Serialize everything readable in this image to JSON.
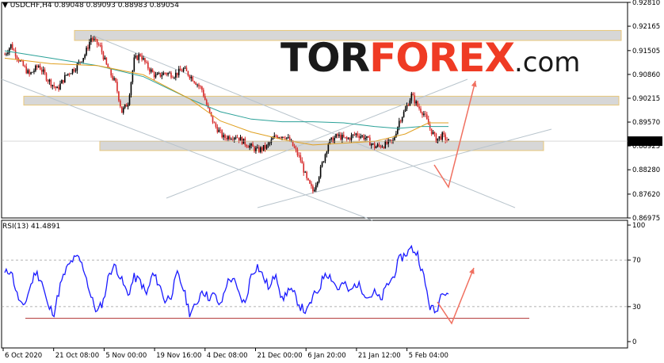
{
  "symbol": {
    "pair": "USDCHF",
    "timeframe": "H4",
    "open": "0.89048",
    "high": "0.89093",
    "low": "0.88983",
    "close": "0.89054"
  },
  "logo": {
    "part1": "TOR",
    "part2": "FOREX",
    "part3": ".com"
  },
  "rsi": {
    "label": "RSI(13) 41.4891"
  },
  "current_price": "0.89054",
  "colors": {
    "bull": "#000000",
    "bear": "#d62b2b",
    "ma_fast": "#e0a020",
    "ma_slow": "#2aa198",
    "rsi": "#1a1aff",
    "zone": "#d7d7d7",
    "zone_border": "#e8c77a",
    "arrow": "#f07060",
    "channel": "#b8c4cc"
  },
  "chart_data": [
    {
      "type": "candlestick",
      "ylim": [
        0.86975,
        0.9281
      ],
      "yticks": [
        "0.92810",
        "0.92165",
        "0.91505",
        "0.90860",
        "0.90215",
        "0.89570",
        "0.88925",
        "0.88280",
        "0.87620",
        "0.86975"
      ],
      "xticks": [
        "6 Oct 2020",
        "21 Oct 08:00",
        "5 Nov 00:00",
        "19 Nov 16:00",
        "4 Dec 08:00",
        "21 Dec 00:00",
        "6 Jan 20:00",
        "21 Jan 12:00",
        "5 Feb 04:00"
      ],
      "close_path": [
        [
          0,
          0.914
        ],
        [
          4,
          0.9165
        ],
        [
          10,
          0.912
        ],
        [
          16,
          0.9085
        ],
        [
          22,
          0.911
        ],
        [
          28,
          0.9072
        ],
        [
          34,
          0.9045
        ],
        [
          40,
          0.9085
        ],
        [
          46,
          0.9105
        ],
        [
          52,
          0.914
        ],
        [
          56,
          0.9185
        ],
        [
          62,
          0.916
        ],
        [
          66,
          0.911
        ],
        [
          72,
          0.906
        ],
        [
          76,
          0.8985
        ],
        [
          80,
          0.901
        ],
        [
          84,
          0.9125
        ],
        [
          88,
          0.914
        ],
        [
          92,
          0.911
        ],
        [
          98,
          0.908
        ],
        [
          104,
          0.909
        ],
        [
          110,
          0.9085
        ],
        [
          116,
          0.91
        ],
        [
          122,
          0.9075
        ],
        [
          128,
          0.9045
        ],
        [
          132,
          0.899
        ],
        [
          136,
          0.895
        ],
        [
          142,
          0.8915
        ],
        [
          150,
          0.892
        ],
        [
          156,
          0.89
        ],
        [
          164,
          0.888
        ],
        [
          170,
          0.889
        ],
        [
          176,
          0.892
        ],
        [
          182,
          0.892
        ],
        [
          186,
          0.89
        ],
        [
          192,
          0.8855
        ],
        [
          196,
          0.88
        ],
        [
          200,
          0.877
        ],
        [
          204,
          0.8815
        ],
        [
          210,
          0.89
        ],
        [
          216,
          0.892
        ],
        [
          222,
          0.891
        ],
        [
          228,
          0.8925
        ],
        [
          234,
          0.8915
        ],
        [
          240,
          0.889
        ],
        [
          246,
          0.8895
        ],
        [
          252,
          0.8905
        ],
        [
          256,
          0.896
        ],
        [
          260,
          0.899
        ],
        [
          264,
          0.903
        ],
        [
          268,
          0.9
        ],
        [
          272,
          0.898
        ],
        [
          276,
          0.894
        ],
        [
          280,
          0.891
        ],
        [
          284,
          0.892
        ],
        [
          288,
          0.8905
        ]
      ],
      "ma_fast": [
        [
          0,
          0.913
        ],
        [
          30,
          0.9115
        ],
        [
          60,
          0.911
        ],
        [
          90,
          0.9085
        ],
        [
          120,
          0.902
        ],
        [
          140,
          0.896
        ],
        [
          160,
          0.893
        ],
        [
          180,
          0.891
        ],
        [
          200,
          0.8895
        ],
        [
          220,
          0.89
        ],
        [
          240,
          0.8905
        ],
        [
          260,
          0.8925
        ],
        [
          275,
          0.8955
        ],
        [
          288,
          0.8955
        ]
      ],
      "ma_slow": [
        [
          0,
          0.915
        ],
        [
          30,
          0.913
        ],
        [
          60,
          0.911
        ],
        [
          90,
          0.908
        ],
        [
          120,
          0.902
        ],
        [
          140,
          0.8985
        ],
        [
          160,
          0.8965
        ],
        [
          180,
          0.8958
        ],
        [
          200,
          0.8958
        ],
        [
          220,
          0.8955
        ],
        [
          240,
          0.8945
        ],
        [
          255,
          0.894
        ],
        [
          270,
          0.8945
        ],
        [
          288,
          0.8945
        ]
      ],
      "zones": [
        [
          0.9178,
          0.9205
        ],
        [
          0.9003,
          0.9027
        ],
        [
          0.888,
          0.8905
        ]
      ]
    },
    {
      "type": "line",
      "title": "RSI(13) 41.4891",
      "ylim": [
        0,
        100
      ],
      "yticks": [
        "100",
        "70",
        "30",
        "0"
      ],
      "levels": [
        70,
        30
      ],
      "values": [
        [
          0,
          58
        ],
        [
          4,
          62
        ],
        [
          8,
          40
        ],
        [
          12,
          28
        ],
        [
          16,
          45
        ],
        [
          20,
          60
        ],
        [
          24,
          52
        ],
        [
          28,
          30
        ],
        [
          32,
          25
        ],
        [
          36,
          48
        ],
        [
          40,
          62
        ],
        [
          44,
          70
        ],
        [
          48,
          72
        ],
        [
          52,
          60
        ],
        [
          56,
          38
        ],
        [
          60,
          25
        ],
        [
          64,
          35
        ],
        [
          68,
          60
        ],
        [
          72,
          65
        ],
        [
          76,
          52
        ],
        [
          80,
          40
        ],
        [
          84,
          55
        ],
        [
          88,
          52
        ],
        [
          92,
          40
        ],
        [
          96,
          58
        ],
        [
          100,
          50
        ],
        [
          104,
          35
        ],
        [
          108,
          40
        ],
        [
          112,
          58
        ],
        [
          116,
          45
        ],
        [
          120,
          25
        ],
        [
          124,
          30
        ],
        [
          128,
          45
        ],
        [
          132,
          38
        ],
        [
          136,
          40
        ],
        [
          140,
          30
        ],
        [
          144,
          50
        ],
        [
          148,
          55
        ],
        [
          152,
          40
        ],
        [
          156,
          32
        ],
        [
          160,
          58
        ],
        [
          164,
          65
        ],
        [
          168,
          55
        ],
        [
          172,
          45
        ],
        [
          176,
          60
        ],
        [
          180,
          35
        ],
        [
          184,
          45
        ],
        [
          188,
          40
        ],
        [
          192,
          30
        ],
        [
          196,
          25
        ],
        [
          200,
          38
        ],
        [
          204,
          45
        ],
        [
          208,
          60
        ],
        [
          212,
          55
        ],
        [
          216,
          45
        ],
        [
          220,
          50
        ],
        [
          224,
          42
        ],
        [
          228,
          50
        ],
        [
          232,
          45
        ],
        [
          236,
          38
        ],
        [
          240,
          42
        ],
        [
          244,
          35
        ],
        [
          248,
          48
        ],
        [
          252,
          55
        ],
        [
          256,
          70
        ],
        [
          260,
          75
        ],
        [
          264,
          80
        ],
        [
          268,
          75
        ],
        [
          272,
          55
        ],
        [
          276,
          30
        ],
        [
          280,
          25
        ],
        [
          284,
          45
        ],
        [
          288,
          42
        ]
      ]
    }
  ]
}
